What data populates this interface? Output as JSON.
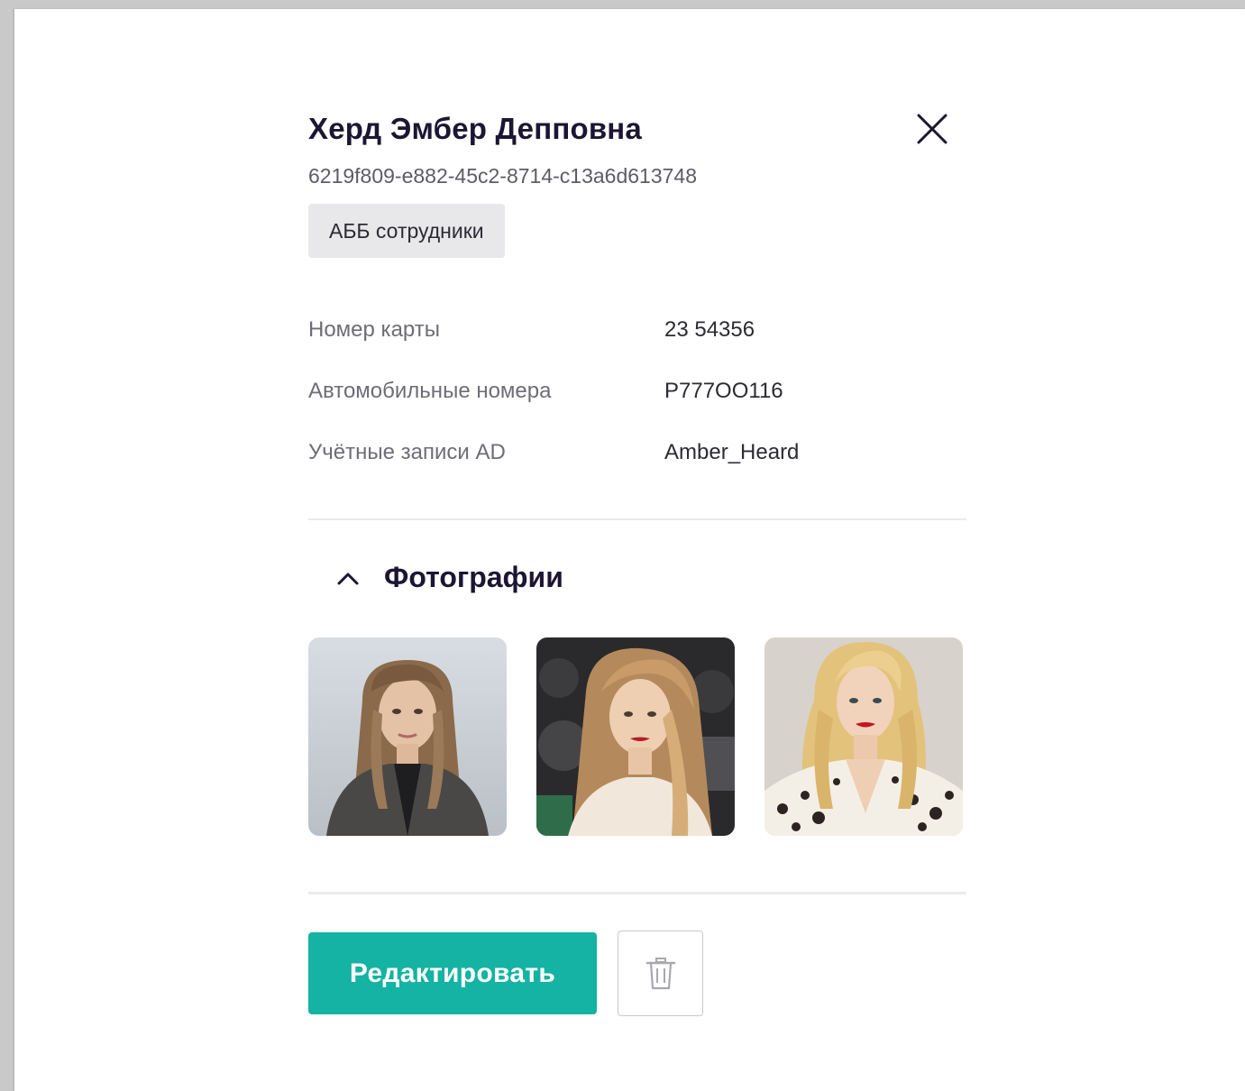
{
  "person": {
    "full_name": "Херд Эмбер Депповна",
    "id": "6219f809-e882-45c2-8714-c13a6d613748",
    "group": "АББ сотрудники"
  },
  "fields": [
    {
      "label": "Номер карты",
      "value": "23 54356"
    },
    {
      "label": "Автомобильные номера",
      "value": "Р777ОО116"
    },
    {
      "label": "Учётные записи AD",
      "value": "Amber_Heard"
    }
  ],
  "photos_section": {
    "title": "Фотографии",
    "expanded": true,
    "photos": [
      {
        "name": "photo-1"
      },
      {
        "name": "photo-2"
      },
      {
        "name": "photo-3"
      }
    ]
  },
  "actions": {
    "edit_label": "Редактировать",
    "delete_icon": "trash-icon",
    "close_icon": "close-icon"
  },
  "colors": {
    "accent": "#14b3a3",
    "title": "#1c1633",
    "chip_bg": "#e8e8ea"
  }
}
